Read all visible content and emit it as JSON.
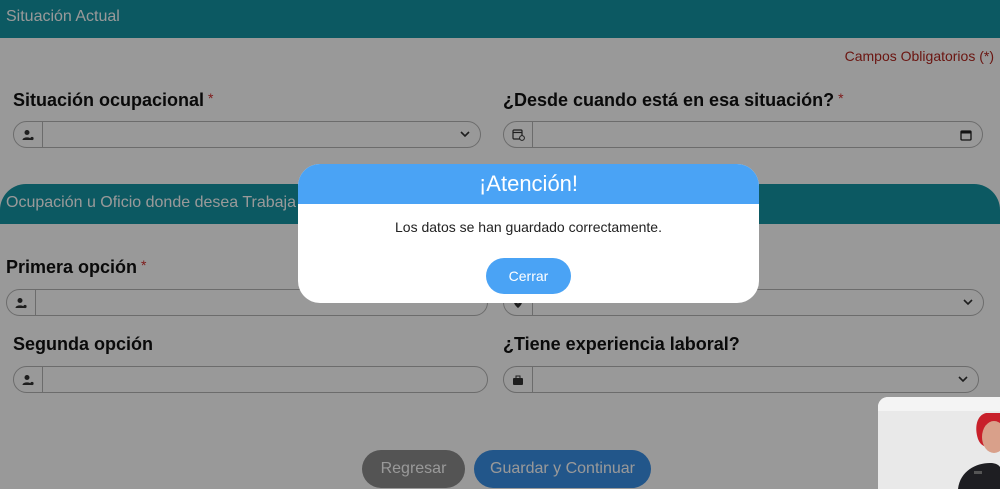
{
  "sections": {
    "current_situation": "Situación Actual",
    "occupation": "Ocupación u Oficio donde desea Trabaja"
  },
  "required_note": "Campos Obligatorios (*)",
  "fields": {
    "occupational_status": {
      "label": "Situación ocupacional",
      "star": "*"
    },
    "since_when": {
      "label": "¿Desde cuando está en esa situación?",
      "star": "*"
    },
    "first_option": {
      "label": "Primera opción",
      "star": "*"
    },
    "second_option": {
      "label": "Segunda opción"
    },
    "work_experience": {
      "label": "¿Tiene experiencia laboral?"
    }
  },
  "buttons": {
    "back": "Regresar",
    "save_continue": "Guardar y Continuar"
  },
  "modal": {
    "title": "¡Atención!",
    "message": "Los datos se han guardado correctamente.",
    "close": "Cerrar"
  },
  "colors": {
    "section_bar": "#1594a3",
    "modal_header": "#4aa3f5",
    "primary_button": "#3a8fe6",
    "secondary_button": "#8c8c8c",
    "required": "#b3261e"
  }
}
